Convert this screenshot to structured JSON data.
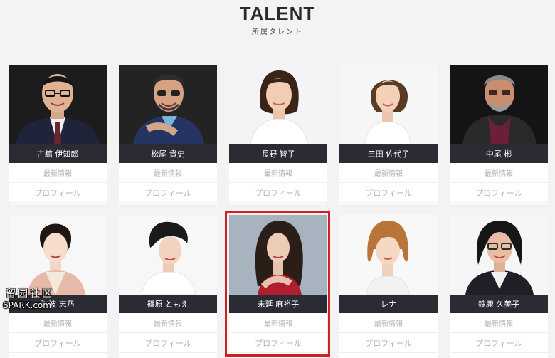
{
  "header": {
    "title": "TALENT",
    "subtitle": "所属タレント"
  },
  "talents": [
    {
      "name": "古舘 伊知郎",
      "news": "最新情報",
      "profile": "プロフィール"
    },
    {
      "name": "松尾 貴史",
      "news": "最新情報",
      "profile": "プロフィール"
    },
    {
      "name": "長野 智子",
      "news": "最新情報",
      "profile": "プロフィール"
    },
    {
      "name": "三田 佐代子",
      "news": "最新情報",
      "profile": "プロフィール"
    },
    {
      "name": "中尾 彬",
      "news": "最新情報",
      "profile": "プロフィール"
    },
    {
      "name": "池波 志乃",
      "news": "最新情報",
      "profile": "プロフィール"
    },
    {
      "name": "篠原 ともえ",
      "news": "最新情報",
      "profile": "プロフィール"
    },
    {
      "name": "末延 麻裕子",
      "news": "最新情報",
      "profile": "プロフィール"
    },
    {
      "name": "レナ",
      "news": "最新情報",
      "profile": "プロフィール"
    },
    {
      "name": "鈴鹿 久美子",
      "news": "最新情報",
      "profile": "プロフィール"
    }
  ],
  "watermark": {
    "line1": "留园社区",
    "line2": "6PARK.com"
  }
}
